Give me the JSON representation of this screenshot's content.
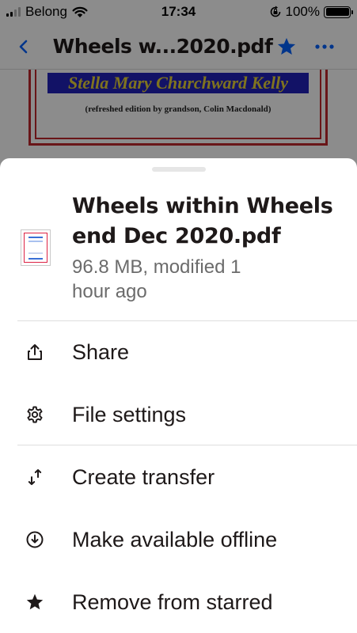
{
  "status_bar": {
    "carrier": "Belong",
    "time": "17:34",
    "battery": "100%",
    "battery_level": 1.0
  },
  "navbar": {
    "title": "Wheels w...2020.pdf",
    "back_icon": "chevron-left-icon",
    "star_icon": "star-filled-icon",
    "more_icon": "ellipsis-icon",
    "accent": "#0061fe"
  },
  "preview": {
    "author_name": "Stella Mary Churchward Kelly",
    "subtitle": "(refreshed edition by grandson, Colin Macdonald)"
  },
  "sheet": {
    "file": {
      "title": "Wheels within Wheels end Dec 2020.pdf",
      "meta": "96.8 MB, modified 1 hour ago",
      "icon": "pdf-thumbnail"
    },
    "actions": [
      {
        "label": "Share",
        "icon": "share-icon"
      },
      {
        "label": "File settings",
        "icon": "gear-icon"
      },
      {
        "label": "Create transfer",
        "icon": "transfer-arrows-icon"
      },
      {
        "label": "Make available offline",
        "icon": "download-circle-icon"
      },
      {
        "label": "Remove from starred",
        "icon": "star-filled-icon"
      }
    ]
  }
}
